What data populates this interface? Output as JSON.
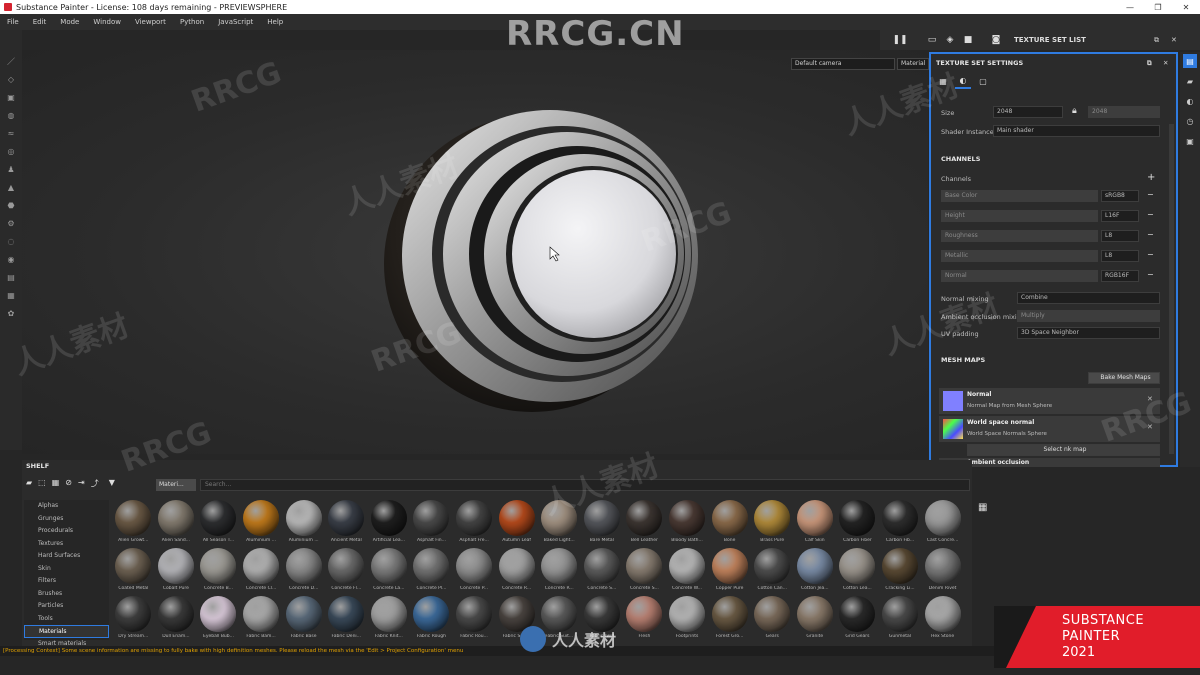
{
  "titlebar": {
    "title": "Substance Painter - License: 108 days remaining - PREVIEWSPHERE",
    "min": "—",
    "max": "❐",
    "close": "✕"
  },
  "menu": [
    "File",
    "Edit",
    "Mode",
    "Window",
    "Viewport",
    "Python",
    "JavaScript",
    "Help"
  ],
  "viewport": {
    "camera": "Default camera",
    "mode": "Material",
    "panel_label": "TEXTURE SET LIST"
  },
  "tss": {
    "title": "TEXTURE SET SETTINGS",
    "size_label": "Size",
    "size_value": "2048",
    "size_locked_value": "2048",
    "shader_label": "Shader Instance",
    "shader_value": "Main shader",
    "channels_title": "CHANNELS",
    "channels_label": "Channels",
    "channels": [
      {
        "name": "Base Color",
        "format": "sRGB8"
      },
      {
        "name": "Height",
        "format": "L16F"
      },
      {
        "name": "Roughness",
        "format": "L8"
      },
      {
        "name": "Metallic",
        "format": "L8"
      },
      {
        "name": "Normal",
        "format": "RGB16F"
      }
    ],
    "normal_mixing_label": "Normal mixing",
    "normal_mixing_value": "Combine",
    "ao_mixing_label": "Ambient occlusion mixing",
    "ao_mixing_value": "Multiply",
    "uv_padding_label": "UV padding",
    "uv_padding_value": "3D Space Neighbor",
    "mesh_maps_title": "MESH MAPS",
    "bake_button": "Bake Mesh Maps",
    "mesh_maps": [
      {
        "name": "Normal",
        "desc": "Normal Map from Mesh Sphere",
        "color": "#8080ff"
      },
      {
        "name": "World space normal",
        "desc": "World Space Normals Sphere",
        "color": "#8a5cc0"
      }
    ],
    "select_map": "Select nk map",
    "ao_partial": "Ambient occlusion"
  },
  "shelf": {
    "title": "SHELF",
    "chip": "Materi...",
    "search_placeholder": "Search...",
    "categories": [
      "Alphas",
      "Grunges",
      "Procedurals",
      "Textures",
      "Hard Surfaces",
      "Skin",
      "Filters",
      "Brushes",
      "Particles",
      "Tools",
      "Materials",
      "Smart materials"
    ],
    "active_category": "Materials",
    "materials": [
      {
        "label": "Alien Growt...",
        "color": "#6b5a46"
      },
      {
        "label": "Alien Sand...",
        "color": "#837b6f"
      },
      {
        "label": "All Season T...",
        "color": "#2d2e30"
      },
      {
        "label": "Aluminium ...",
        "color": "#c07a1c"
      },
      {
        "label": "Aluminium ...",
        "color": "#b8b8b8"
      },
      {
        "label": "Ancient Metal",
        "color": "#3a3f48"
      },
      {
        "label": "Artificial Lea...",
        "color": "#1f1f1f"
      },
      {
        "label": "Asphalt Fin...",
        "color": "#4a4a4a"
      },
      {
        "label": "Asphalt Fre...",
        "color": "#444444"
      },
      {
        "label": "Autumn Leaf",
        "color": "#b54a1c"
      },
      {
        "label": "Baked Light...",
        "color": "#a09080"
      },
      {
        "label": "Bare Metal",
        "color": "#55575c"
      },
      {
        "label": "Bell Leather",
        "color": "#3d3632"
      },
      {
        "label": "Bloody Bath...",
        "color": "#4a3a34"
      },
      {
        "label": "Bone",
        "color": "#8a6a4a"
      },
      {
        "label": "Brass Pure",
        "color": "#b08a3a"
      },
      {
        "label": "Calf Skin",
        "color": "#c8967a"
      },
      {
        "label": "Carbon Fiber",
        "color": "#242424"
      },
      {
        "label": "Carbon Fib...",
        "color": "#2e2e2e"
      },
      {
        "label": "Cast Concre...",
        "color": "#9a9a9a"
      },
      {
        "label": "Coated Metal",
        "color": "#6e6253"
      },
      {
        "label": "Cobalt Pure",
        "color": "#b4b4b8"
      },
      {
        "label": "Concrete B...",
        "color": "#9c9a94"
      },
      {
        "label": "Concrete Cl...",
        "color": "#b0b0b0"
      },
      {
        "label": "Concrete D...",
        "color": "#8a8a8a"
      },
      {
        "label": "Concrete Fl...",
        "color": "#6a6a6a"
      },
      {
        "label": "Concrete La...",
        "color": "#7c7c7c"
      },
      {
        "label": "Concrete Pl...",
        "color": "#737373"
      },
      {
        "label": "Concrete P...",
        "color": "#8f8f8f"
      },
      {
        "label": "Concrete R...",
        "color": "#a2a2a2"
      },
      {
        "label": "Concrete R...",
        "color": "#969696"
      },
      {
        "label": "Concrete S...",
        "color": "#5c5c5c"
      },
      {
        "label": "Concrete S...",
        "color": "#877c70"
      },
      {
        "label": "Concrete W...",
        "color": "#b6b6b6"
      },
      {
        "label": "Copper Pure",
        "color": "#c0825c"
      },
      {
        "label": "Cotton Can...",
        "color": "#4e4e4e"
      },
      {
        "label": "Cotton Jea...",
        "color": "#7a8ca6"
      },
      {
        "label": "Cotton Lea...",
        "color": "#9a948c"
      },
      {
        "label": "Cracking Li...",
        "color": "#5a4a34"
      },
      {
        "label": "Denim Rivet",
        "color": "#7a7a7a"
      },
      {
        "label": "Dry Stream...",
        "color": "#3e3e3e"
      },
      {
        "label": "Dull Enam...",
        "color": "#3a3a3a"
      },
      {
        "label": "Eyeball Bub...",
        "color": "#d8c8d8"
      },
      {
        "label": "Fabric Bam...",
        "color": "#a8a8a8"
      },
      {
        "label": "Fabric Base",
        "color": "#5a6a7a"
      },
      {
        "label": "Fabric Deni...",
        "color": "#3a4a5a"
      },
      {
        "label": "Fabric Knit...",
        "color": "#a0a0a0"
      },
      {
        "label": "Fabric Rough",
        "color": "#3c6a9a"
      },
      {
        "label": "Fabric Rou...",
        "color": "#4a4a4a"
      },
      {
        "label": "Fabric Soft...",
        "color": "#4a4440"
      },
      {
        "label": "Fabric Suit...",
        "color": "#5a5a5a"
      },
      {
        "label": "Fabric Twill",
        "color": "#3a3a3a"
      },
      {
        "label": "Flesh",
        "color": "#b88072"
      },
      {
        "label": "Footprints",
        "color": "#b4b4b4"
      },
      {
        "label": "Forest Gro...",
        "color": "#6a5a44"
      },
      {
        "label": "Gears",
        "color": "#7a6a5a"
      },
      {
        "label": "Granite",
        "color": "#8a7a6a"
      },
      {
        "label": "Grid Gears",
        "color": "#2a2a2a"
      },
      {
        "label": "Gunmetal",
        "color": "#4a4a4a"
      },
      {
        "label": "Hex Stone",
        "color": "#a8a8a8"
      }
    ]
  },
  "status": "[Processing Context] Some scene information are missing to fully bake with high definition meshes. Please reload the mesh via the 'Edit > Project Configuration' menu",
  "brand": {
    "line1": "SUBSTANCE",
    "line2": "PAINTER",
    "line3": "2021"
  },
  "watermarks": {
    "main": "RRCG.CN",
    "rrcg": "RRCG",
    "cn": "人人素材",
    "logo": "人人素材"
  },
  "icons": {
    "pause": "pause-icon",
    "folder": "folder-icon",
    "cube": "cube-icon",
    "camera": "camera-icon",
    "screenshot": "screenshot-icon"
  }
}
